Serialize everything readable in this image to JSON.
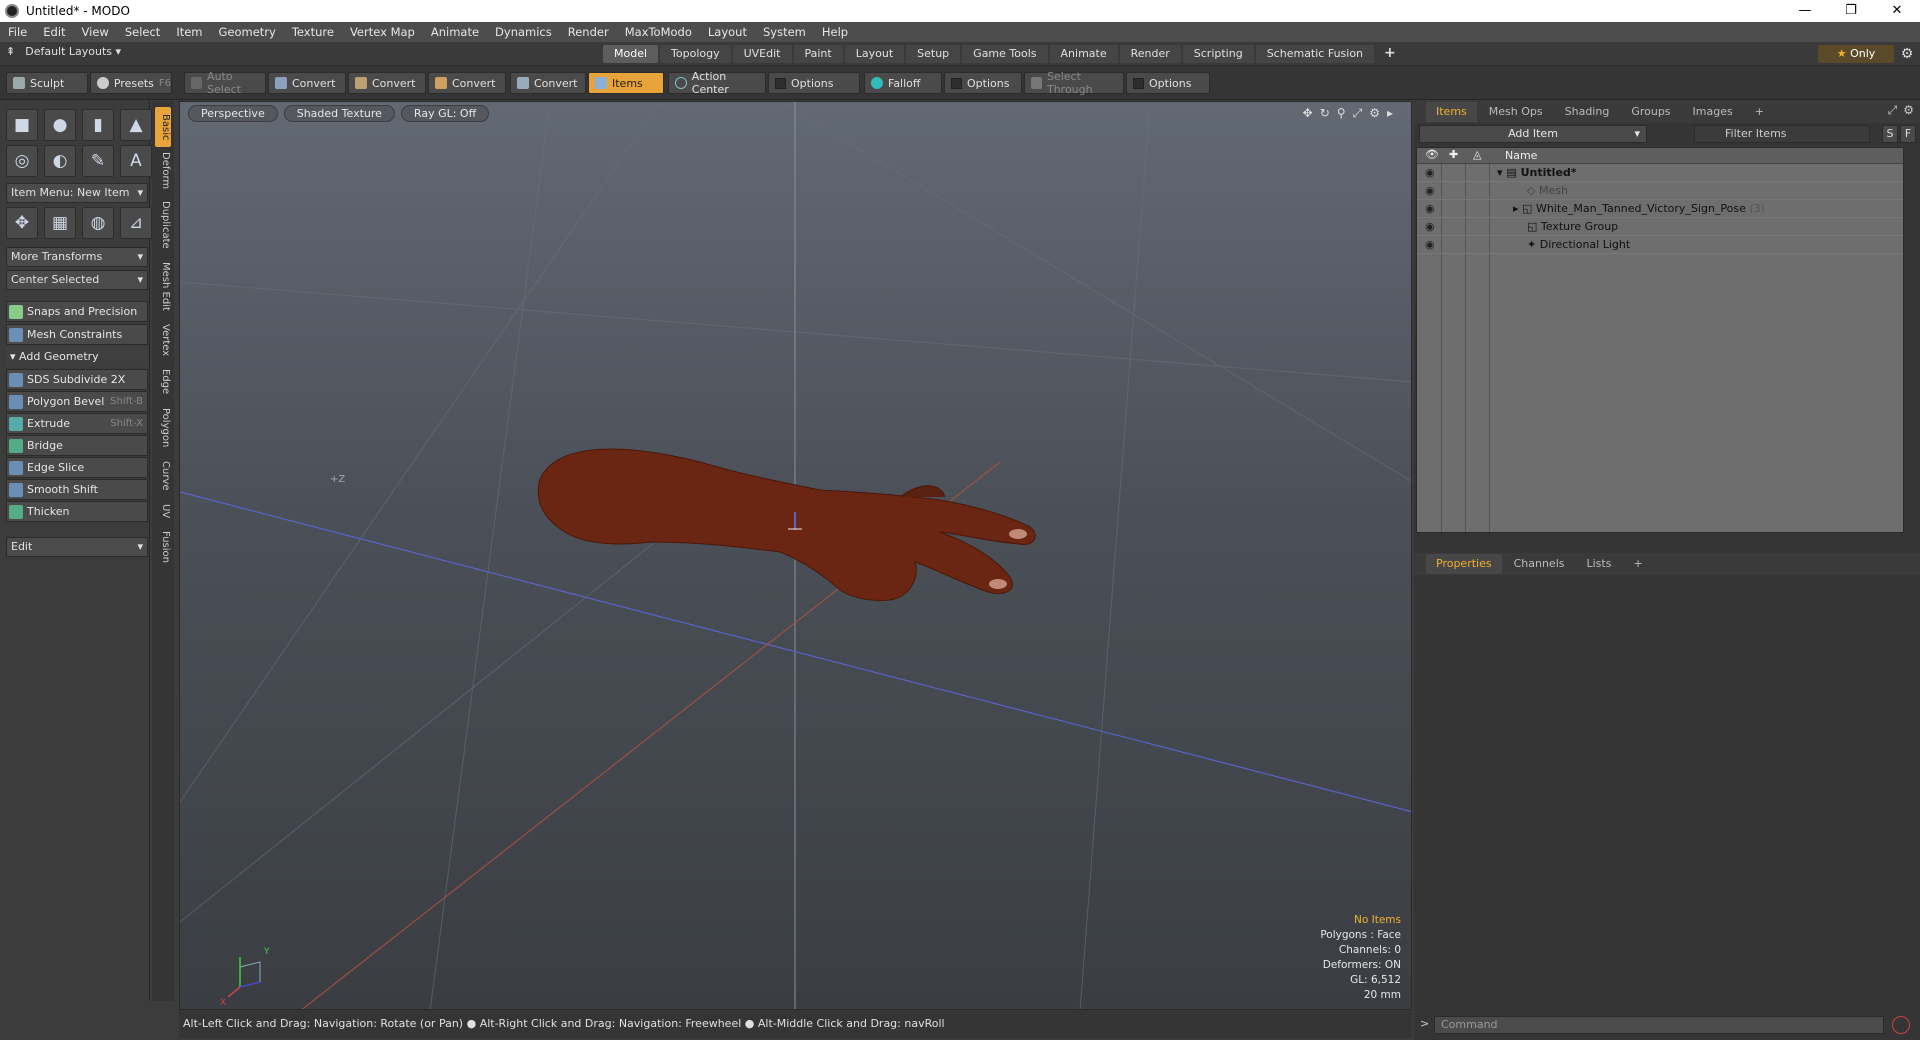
{
  "window": {
    "title": "Untitled* - MODO",
    "min": "—",
    "max": "❐",
    "close": "✕"
  },
  "menu": [
    "File",
    "Edit",
    "View",
    "Select",
    "Item",
    "Geometry",
    "Texture",
    "Vertex Map",
    "Animate",
    "Dynamics",
    "Render",
    "MaxToModo",
    "Layout",
    "System",
    "Help"
  ],
  "layout": {
    "default": "Default Layouts ▾",
    "tabs": [
      "Model",
      "Topology",
      "UVEdit",
      "Paint",
      "Layout",
      "Setup",
      "Game Tools",
      "Animate",
      "Render",
      "Scripting",
      "Schematic Fusion"
    ],
    "active_tab": "Model",
    "plus": "+",
    "only": "Only"
  },
  "toolbar": {
    "sculpt": "Sculpt",
    "presets": "Presets",
    "presets_key": "F6",
    "auto_select": "Auto Select",
    "convert": "Convert",
    "items": "Items",
    "action_center": "Action Center",
    "options": "Options",
    "falloff": "Falloff",
    "select_through": "Select Through"
  },
  "left": {
    "item_menu": "Item Menu: New Item",
    "more_transforms": "More Transforms",
    "center_selected": "Center Selected",
    "snaps": "Snaps and Precision",
    "mesh_constraints": "Mesh Constraints",
    "add_geometry": "Add Geometry",
    "tools": [
      {
        "label": "SDS Subdivide 2X",
        "key": ""
      },
      {
        "label": "Polygon Bevel",
        "key": "Shift-B"
      },
      {
        "label": "Extrude",
        "key": "Shift-X"
      },
      {
        "label": "Bridge",
        "key": ""
      },
      {
        "label": "Edge Slice",
        "key": ""
      },
      {
        "label": "Smooth Shift",
        "key": ""
      },
      {
        "label": "Thicken",
        "key": ""
      }
    ],
    "edit": "Edit",
    "vtabs": [
      "Basic",
      "Deform",
      "Duplicate",
      "Mesh Edit",
      "Vertex",
      "Edge",
      "Polygon",
      "Curve",
      "UV",
      "Fusion"
    ]
  },
  "viewport": {
    "perspective": "Perspective",
    "shaded": "Shaded Texture",
    "raygl": "Ray GL: Off",
    "info": {
      "no_items": "No Items",
      "polygons": "Polygons : Face",
      "channels": "Channels: 0",
      "deformers": "Deformers: ON",
      "gl": "GL: 6,512",
      "unit": "20 mm"
    },
    "axis_y": "Y",
    "axis_x": "X",
    "axis_z": "+Z"
  },
  "status": "Alt-Left Click and Drag: Navigation: Rotate (or Pan) ● Alt-Right Click and Drag: Navigation: Freewheel ● Alt-Middle Click and Drag: navRoll",
  "right": {
    "tabs": [
      "Items",
      "Mesh Ops",
      "Shading",
      "Groups",
      "Images"
    ],
    "add_item": "Add Item",
    "filter": "Filter Items",
    "s": "S",
    "f": "F",
    "name_col": "Name",
    "tree": [
      {
        "label": "Untitled*",
        "indent": 0
      },
      {
        "label": "Mesh",
        "indent": 1
      },
      {
        "label": "White_Man_Tanned_Victory_Sign_Pose",
        "count": "(3)",
        "indent": 1
      },
      {
        "label": "Texture Group",
        "indent": 1
      },
      {
        "label": "Directional Light",
        "indent": 1
      }
    ],
    "tabs2": [
      "Properties",
      "Channels",
      "Lists"
    ],
    "command": "Command"
  },
  "colors": {
    "accent": "#e8a33a",
    "highlight": "#f2b12c",
    "hand": "#6a2612"
  }
}
